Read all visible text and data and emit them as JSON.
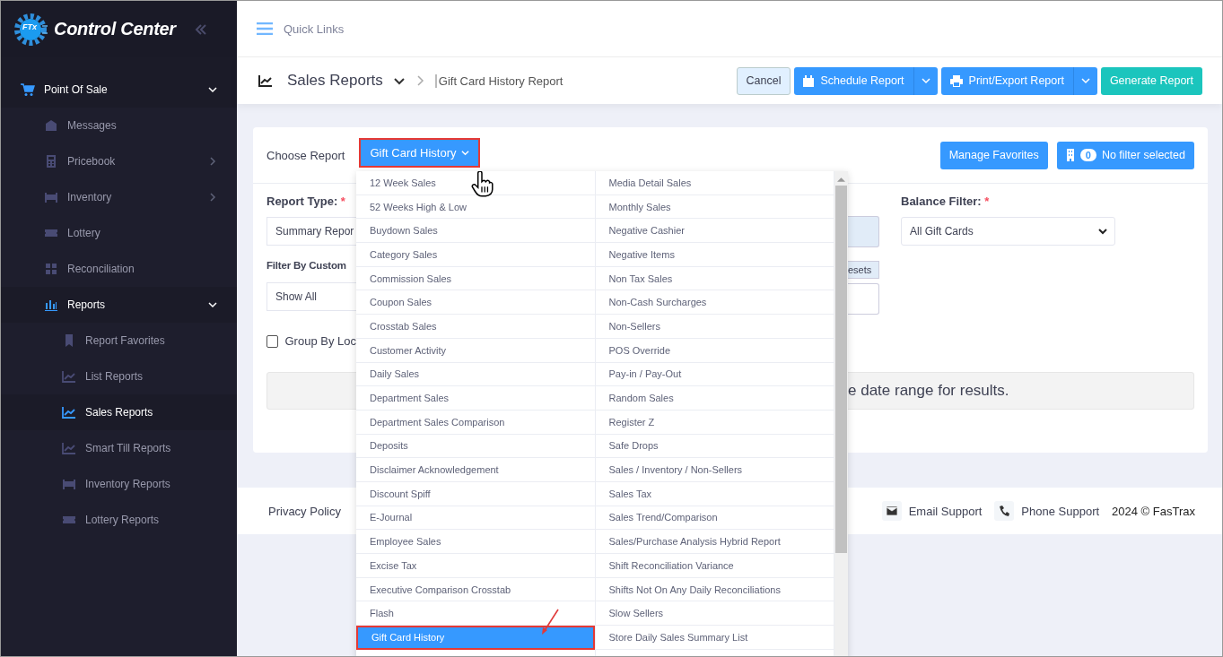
{
  "brand": {
    "title": "Control Center",
    "logo_text": "FTx"
  },
  "topbar": {
    "quick_links": "Quick Links"
  },
  "sidebar": {
    "items": [
      {
        "label": "Point Of Sale",
        "expanded": true,
        "selected": false,
        "children": [
          {
            "label": "Messages",
            "selected": false
          },
          {
            "label": "Pricebook",
            "expanded": false,
            "selected": false
          },
          {
            "label": "Inventory",
            "expanded": false,
            "selected": false
          },
          {
            "label": "Lottery",
            "selected": false
          },
          {
            "label": "Reconciliation",
            "selected": false
          },
          {
            "label": "Reports",
            "expanded": true,
            "selected": false,
            "children": [
              {
                "label": "Report Favorites",
                "selected": false
              },
              {
                "label": "List Reports",
                "selected": false
              },
              {
                "label": "Sales Reports",
                "selected": true
              },
              {
                "label": "Smart Till Reports",
                "selected": false
              },
              {
                "label": "Inventory Reports",
                "selected": false
              },
              {
                "label": "Lottery Reports",
                "selected": false
              }
            ]
          }
        ]
      }
    ]
  },
  "header": {
    "section": "Sales Reports",
    "current": "Gift Card History Report",
    "buttons": [
      {
        "kind": "plain",
        "label": "Cancel"
      },
      {
        "kind": "split",
        "label": "Schedule Report"
      },
      {
        "kind": "split",
        "label": "Print/Export Report"
      },
      {
        "kind": "primary",
        "label": "Generate Report"
      }
    ]
  },
  "card": {
    "choose_label": "Choose Report",
    "report_button": "Gift Card History",
    "manage_favorites": "Manage Favorites",
    "filter_count": "0",
    "filter_label": "No filter selected",
    "report_type_label": "Report Type:",
    "report_type_required": true,
    "balance_required": true,
    "required_mark": "*",
    "report_type_value": "Summary Repor",
    "customer_filter_label": "Filter By Custom",
    "customer_filter_value": "Show All",
    "group_by_label": "Group By Loc",
    "group_by_checked": false,
    "presets_fragment": "esets",
    "balance_label": "Balance Filter:",
    "balance_value": "All Gift Cards",
    "message": "e date range for results."
  },
  "report_menu": {
    "left": [
      {
        "label": "12 Week Sales",
        "selected": false
      },
      {
        "label": "52 Weeks High & Low",
        "selected": false
      },
      {
        "label": "Buydown Sales",
        "selected": false
      },
      {
        "label": "Category Sales",
        "selected": false
      },
      {
        "label": "Commission Sales",
        "selected": false
      },
      {
        "label": "Coupon Sales",
        "selected": false
      },
      {
        "label": "Crosstab Sales",
        "selected": false
      },
      {
        "label": "Customer Activity",
        "selected": false
      },
      {
        "label": "Daily Sales",
        "selected": false
      },
      {
        "label": "Department Sales",
        "selected": false
      },
      {
        "label": "Department Sales Comparison",
        "selected": false
      },
      {
        "label": "Deposits",
        "selected": false
      },
      {
        "label": "Disclaimer Acknowledgement",
        "selected": false
      },
      {
        "label": "Discount Spiff",
        "selected": false
      },
      {
        "label": "E-Journal",
        "selected": false
      },
      {
        "label": "Employee Sales",
        "selected": false
      },
      {
        "label": "Excise Tax",
        "selected": false
      },
      {
        "label": "Executive Comparison Crosstab",
        "selected": false
      },
      {
        "label": "Flash",
        "selected": false
      },
      {
        "label": "Gift Card History",
        "selected": true
      }
    ],
    "right": [
      {
        "label": "Media Detail Sales",
        "selected": false
      },
      {
        "label": "Monthly Sales",
        "selected": false
      },
      {
        "label": "Negative Cashier",
        "selected": false
      },
      {
        "label": "Negative Items",
        "selected": false
      },
      {
        "label": "Non Tax Sales",
        "selected": false
      },
      {
        "label": "Non-Cash Surcharges",
        "selected": false
      },
      {
        "label": "Non-Sellers",
        "selected": false
      },
      {
        "label": "POS Override",
        "selected": false
      },
      {
        "label": "Pay-in / Pay-Out",
        "selected": false
      },
      {
        "label": "Random Sales",
        "selected": false
      },
      {
        "label": "Register Z",
        "selected": false
      },
      {
        "label": "Safe Drops",
        "selected": false
      },
      {
        "label": "Sales / Inventory / Non-Sellers",
        "selected": false
      },
      {
        "label": "Sales Tax",
        "selected": false
      },
      {
        "label": "Sales Trend/Comparison",
        "selected": false
      },
      {
        "label": "Sales/Purchase Analysis Hybrid Report",
        "selected": false
      },
      {
        "label": "Shift Reconciliation Variance",
        "selected": false
      },
      {
        "label": "Shifts Not On Any Daily Reconciliations",
        "selected": false
      },
      {
        "label": "Slow Sellers",
        "selected": false
      },
      {
        "label": "Store Daily Sales Summary List",
        "selected": false
      }
    ]
  },
  "footer": {
    "privacy": "Privacy Policy",
    "email": "Email Support",
    "phone": "Phone Support",
    "copyright": "2024 © FasTrax"
  }
}
